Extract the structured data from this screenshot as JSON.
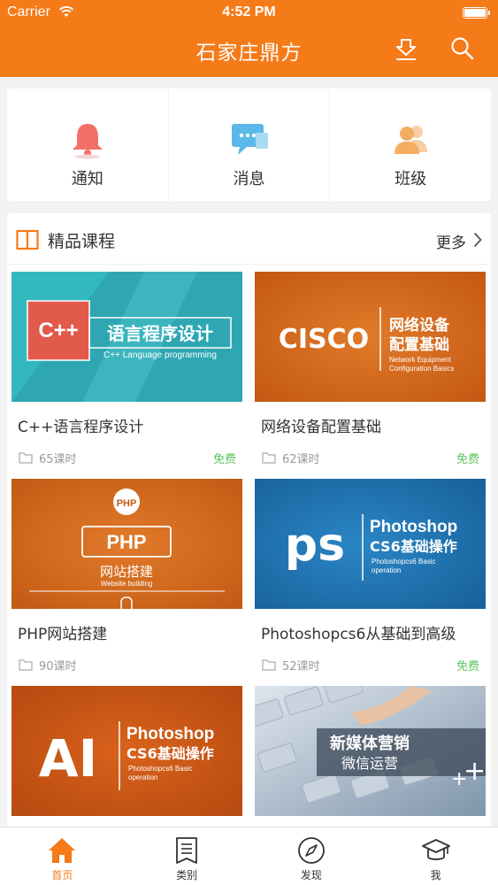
{
  "status_bar": {
    "carrier": "Carrier",
    "time": "4:52 PM"
  },
  "header": {
    "title": "石家庄鼎方",
    "download_icon": "download-icon",
    "search_icon": "search-icon",
    "bg_color": "#f57a18"
  },
  "quick_menu": [
    {
      "label": "通知",
      "icon": "bell-icon"
    },
    {
      "label": "消息",
      "icon": "chat-icon"
    },
    {
      "label": "班级",
      "icon": "people-icon"
    }
  ],
  "courses_section": {
    "title": "精品课程",
    "more_label": "更多"
  },
  "courses": [
    {
      "title": "C++语言程序设计",
      "hours": "65课时",
      "price": "免费",
      "thumb": {
        "badge": "C++",
        "main": "语言程序设计",
        "sub": "C++ Language programming"
      }
    },
    {
      "title": "网络设备配置基础",
      "hours": "62课时",
      "price": "免费",
      "thumb": {
        "badge": "CISCO",
        "main": "网络设备",
        "main2": "配置基础",
        "sub": "Network Equipment",
        "sub2": "Configuration Basics"
      }
    },
    {
      "title": "PHP网站搭建",
      "hours": "90课时",
      "price": "",
      "thumb": {
        "badge": "PHP",
        "main": "PHP",
        "main2": "网站搭建",
        "sub": "Website building"
      }
    },
    {
      "title": "Photoshopcs6从基础到高级",
      "hours": "52课时",
      "price": "免费",
      "thumb": {
        "badge": "ps",
        "main": "Photoshop",
        "main2": "CS6基础操作",
        "sub": "Photoshopcs6 Basic",
        "sub2": "operation"
      }
    },
    {
      "title": "",
      "hours": "",
      "price": "",
      "thumb": {
        "badge": "AI",
        "main": "Photoshop",
        "main2": "CS6基础操作",
        "sub": "Photoshopcs6 Basic",
        "sub2": "operation"
      }
    },
    {
      "title": "",
      "hours": "",
      "price": "",
      "thumb": {
        "main": "新媒体营销",
        "main2": "微信运营"
      }
    }
  ],
  "tabbar": [
    {
      "label": "首页",
      "icon": "home-icon",
      "active": true
    },
    {
      "label": "类别",
      "icon": "list-icon",
      "active": false
    },
    {
      "label": "发现",
      "icon": "compass-icon",
      "active": false
    },
    {
      "label": "我",
      "icon": "graduation-cap-icon",
      "active": false
    }
  ],
  "colors": {
    "accent": "#f57a18",
    "free": "#5cc45c",
    "text": "#333333",
    "muted": "#9a9a9a"
  }
}
